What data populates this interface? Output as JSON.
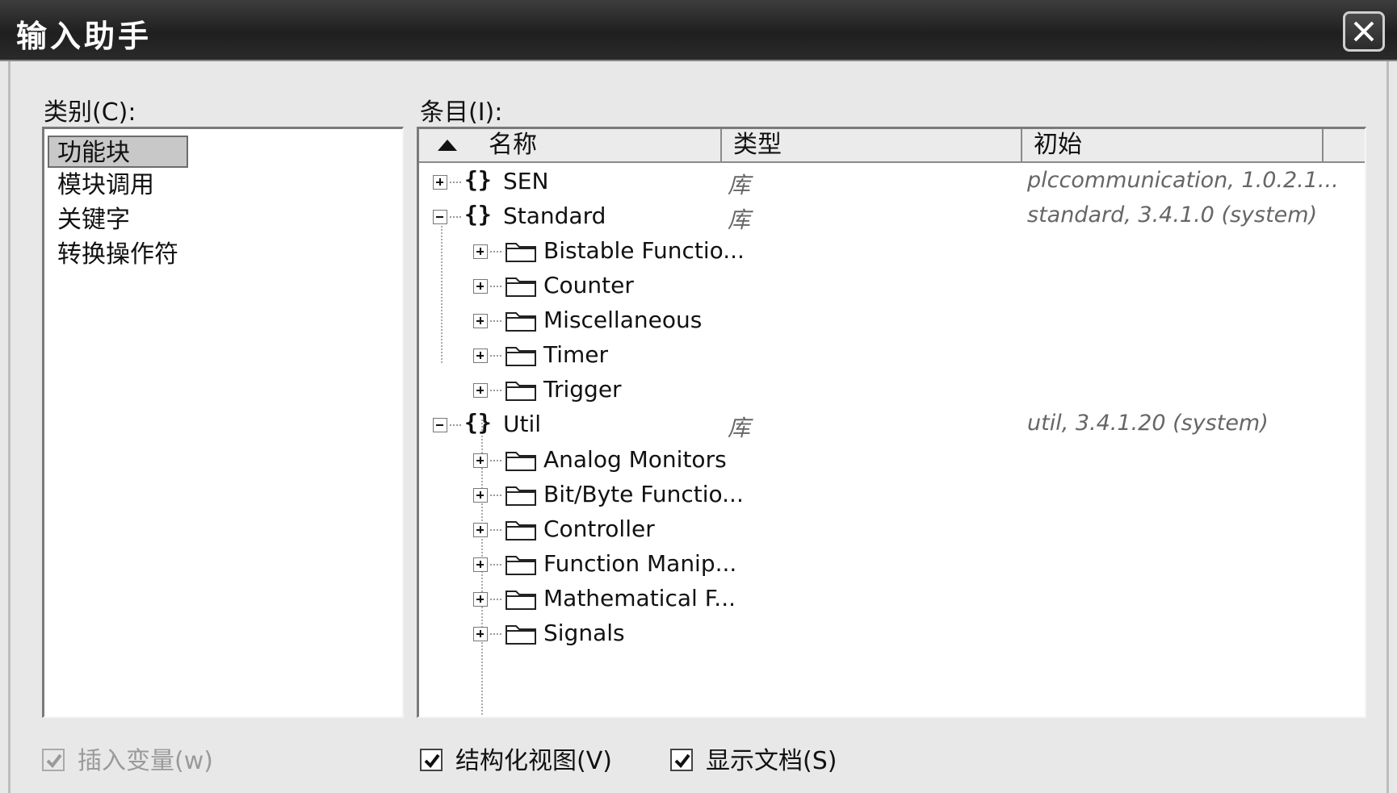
{
  "window": {
    "title": "输入助手",
    "close_icon": "close-icon"
  },
  "category": {
    "label": "类别(C):",
    "items": [
      "功能块",
      "模块调用",
      "关键字",
      "转换操作符"
    ],
    "selected_index": 0
  },
  "entries": {
    "label": "条目(I):",
    "columns": [
      "名称",
      "类型",
      "初始"
    ],
    "sort_indicator": "ascending",
    "rows": [
      {
        "name": "SEN",
        "type": "库",
        "init": "plccommunication, 1.0.2.1...",
        "kind": "library",
        "expanded": false
      },
      {
        "name": "Standard",
        "type": "库",
        "init": "standard, 3.4.1.0 (system)",
        "kind": "library",
        "expanded": true
      },
      {
        "name": "Bistable Functio...",
        "kind": "folder"
      },
      {
        "name": "Counter",
        "kind": "folder"
      },
      {
        "name": "Miscellaneous",
        "kind": "folder"
      },
      {
        "name": "Timer",
        "kind": "folder"
      },
      {
        "name": "Trigger",
        "kind": "folder"
      },
      {
        "name": "Util",
        "type": "库",
        "init": "util, 3.4.1.20 (system)",
        "kind": "library",
        "expanded": true
      },
      {
        "name": "Analog Monitors",
        "kind": "folder"
      },
      {
        "name": "Bit/Byte Functio...",
        "kind": "folder"
      },
      {
        "name": "Controller",
        "kind": "folder"
      },
      {
        "name": "Function Manip...",
        "kind": "folder"
      },
      {
        "name": "Mathematical F...",
        "kind": "folder"
      },
      {
        "name": "Signals",
        "kind": "folder"
      }
    ]
  },
  "options": {
    "insert_variable": {
      "label": "插入变量(w)",
      "checked": true,
      "disabled": true
    },
    "structured_view": {
      "label": "结构化视图(V)",
      "checked": true
    },
    "show_docs": {
      "label": "显示文档(S)",
      "checked": true
    }
  }
}
